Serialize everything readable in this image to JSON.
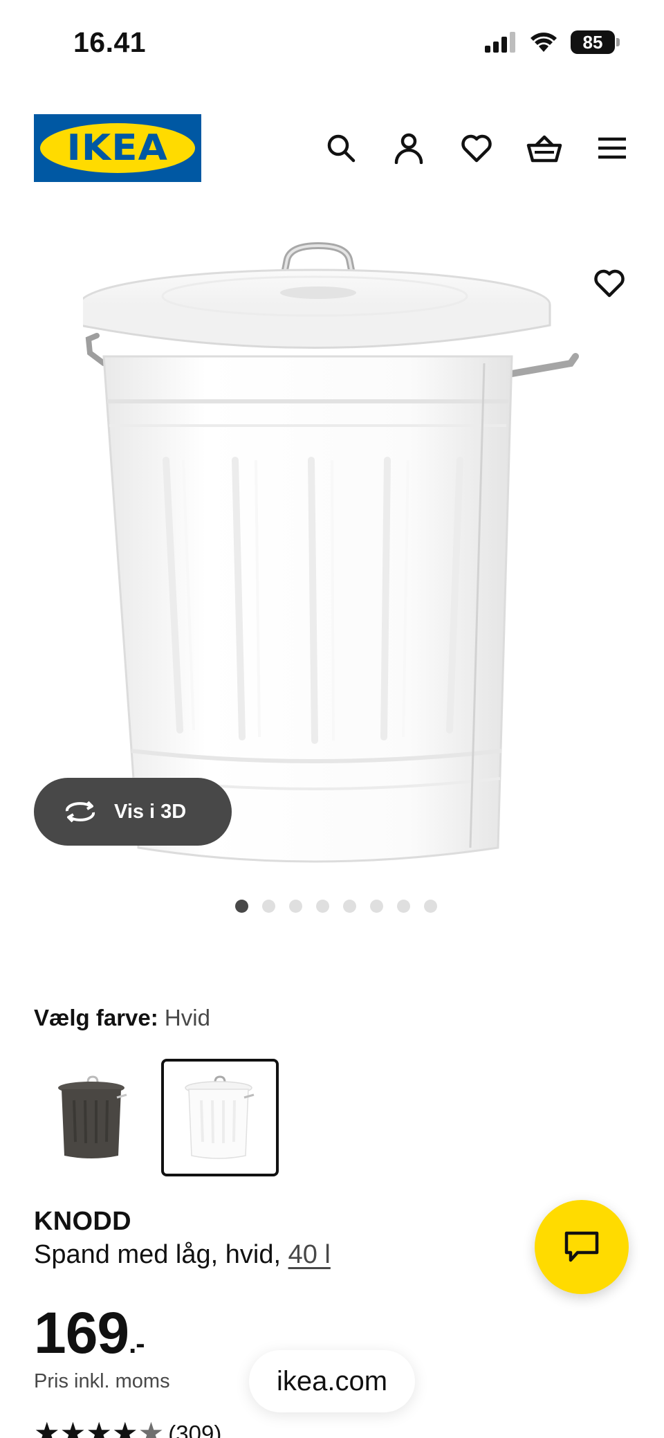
{
  "status_bar": {
    "time": "16.41",
    "battery": "85"
  },
  "header": {
    "logo_text": "IKEA",
    "icons": [
      "search-icon",
      "user-icon",
      "heart-icon",
      "basket-icon",
      "menu-icon"
    ]
  },
  "gallery": {
    "view_3d_label": "Vis i 3D",
    "page_count": 8,
    "active_index": 0
  },
  "color_picker": {
    "label": "Vælg farve:",
    "selected_value": "Hvid",
    "options": [
      "Sort",
      "Hvid"
    ]
  },
  "product": {
    "name": "KNODD",
    "description": "Spand med låg, hvid,",
    "size_link": "40 l",
    "price": "169",
    "price_suffix": ".-",
    "price_note": "Pris inkl. moms",
    "rating_count": "(309)",
    "rating_stars": 4.5
  },
  "browser": {
    "url": "ikea.com"
  },
  "colors": {
    "ikea_blue": "#0058a3",
    "ikea_yellow": "#ffdb00",
    "dark_grey": "#484848"
  }
}
